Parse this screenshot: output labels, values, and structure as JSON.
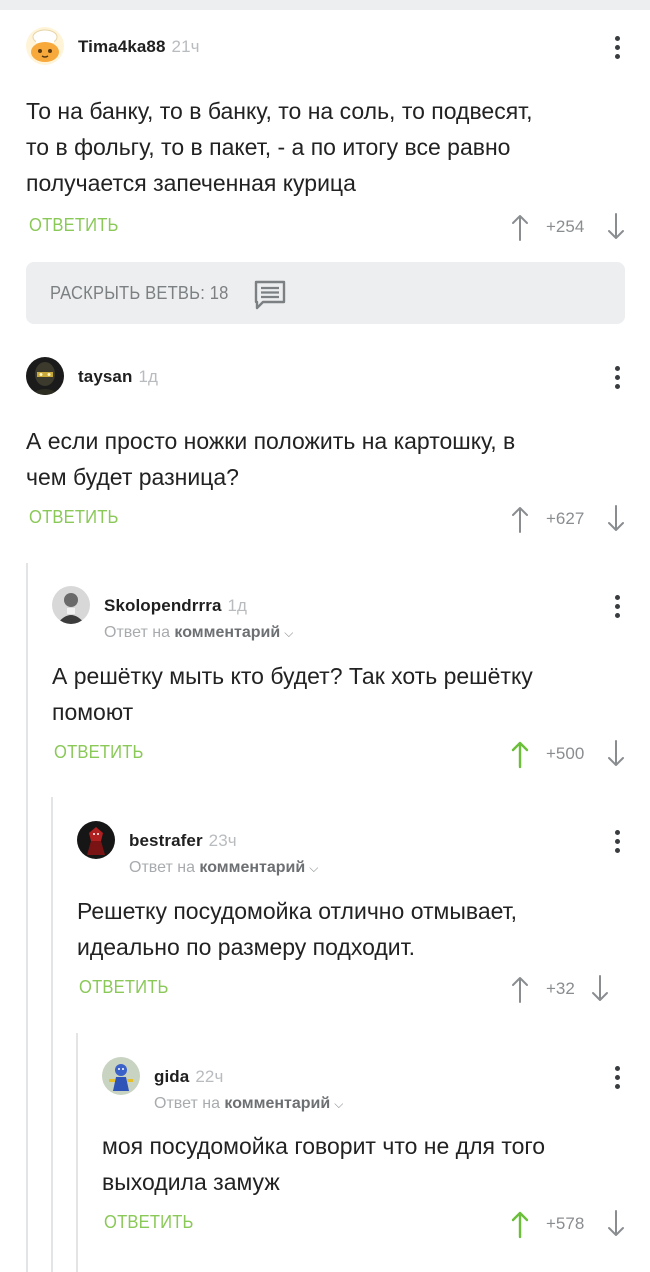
{
  "comments": [
    {
      "username": "Tima4ka88",
      "time": "21ч",
      "text_lines": [
        "То на банку, то в банку, то на соль, то подвесят,",
        "то в фольгу, то в пакет, - а по итогу все равно",
        "получается запеченная курица"
      ],
      "reply_label": "ОТВЕТИТЬ",
      "score": "+254",
      "avatar_icon": "chef-cat-avatar"
    },
    {
      "username": "taysan",
      "time": "1д",
      "text_lines": [
        "А если просто ножки положить на картошку, в",
        "чем будет разница?"
      ],
      "reply_label": "ОТВЕТИТЬ",
      "score": "+627",
      "avatar_icon": "ninja-avatar"
    },
    {
      "username": "Skolopendrrra",
      "time": "1д",
      "reply_prefix": "Ответ на",
      "reply_target": "комментарий",
      "text_lines": [
        "А решётку мыть кто будет? Так хоть решётку",
        "помоют"
      ],
      "reply_label": "ОТВЕТИТЬ",
      "score": "+500",
      "upvoted": true,
      "avatar_icon": "portrait-avatar"
    },
    {
      "username": "bestrafer",
      "time": "23ч",
      "reply_prefix": "Ответ на",
      "reply_target": "комментарий",
      "text_lines": [
        "Решетку посудомойка отлично отмывает,",
        "идеально по размеру подходит."
      ],
      "reply_label": "ОТВЕТИТЬ",
      "score": "+32",
      "upvoted": false,
      "avatar_icon": "red-figure-avatar"
    },
    {
      "username": "gida",
      "time": "22ч",
      "reply_prefix": "Ответ на",
      "reply_target": "комментарий",
      "text_lines": [
        "моя посудомойка говорит что не для того",
        "выходила замуж"
      ],
      "reply_label": "ОТВЕТИТЬ",
      "score": "+578",
      "upvoted": true,
      "avatar_icon": "toy-figure-avatar"
    }
  ],
  "expand_branch": {
    "label": "РАСКРЫТЬ ВЕТВЬ: 18",
    "icon": "comment-lines-icon"
  },
  "colors": {
    "reply_green": "#8ac858",
    "upvote_green": "#6cbf3a",
    "muted_gray": "#a8abae",
    "thread_line": "#e2e4e6"
  }
}
